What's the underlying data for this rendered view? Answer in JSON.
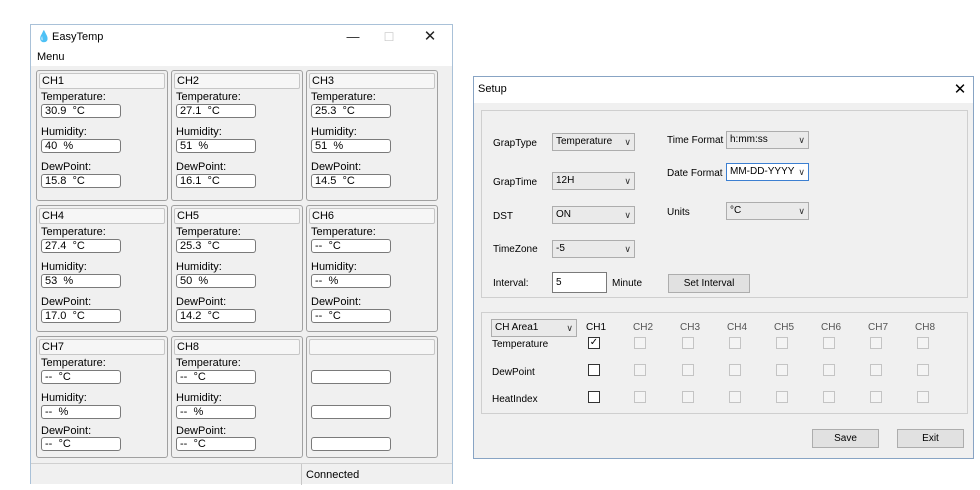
{
  "easytemp": {
    "title": "EasyTemp",
    "menu": "Menu",
    "status": "Connected",
    "labels": {
      "temperature": "Temperature:",
      "humidity": "Humidity:",
      "dewpoint": "DewPoint:"
    },
    "channels": [
      {
        "name": "CH1",
        "temperature": "30.9  °C",
        "humidity": "40  %",
        "dewpoint": "15.8  °C"
      },
      {
        "name": "CH2",
        "temperature": "27.1  °C",
        "humidity": "51  %",
        "dewpoint": "16.1  °C"
      },
      {
        "name": "CH3",
        "temperature": "25.3  °C",
        "humidity": "51  %",
        "dewpoint": "14.5  °C"
      },
      {
        "name": "CH4",
        "temperature": "27.4  °C",
        "humidity": "53  %",
        "dewpoint": "17.0  °C"
      },
      {
        "name": "CH5",
        "temperature": "25.3  °C",
        "humidity": "50  %",
        "dewpoint": "14.2  °C"
      },
      {
        "name": "CH6",
        "temperature": "--  °C",
        "humidity": "--  %",
        "dewpoint": "--  °C"
      },
      {
        "name": "CH7",
        "temperature": "--  °C",
        "humidity": "--  %",
        "dewpoint": "--  °C"
      },
      {
        "name": "CH8",
        "temperature": "--  °C",
        "humidity": "--  %",
        "dewpoint": "--  °C"
      }
    ]
  },
  "setup": {
    "title": "Setup",
    "graptype": {
      "label": "GrapType",
      "value": "Temperature"
    },
    "graptime": {
      "label": "GrapTime",
      "value": "12H"
    },
    "dst": {
      "label": "DST",
      "value": "ON"
    },
    "timezone": {
      "label": "TimeZone",
      "value": "-5"
    },
    "interval": {
      "label": "Interval:",
      "value": "5",
      "unit": "Minute"
    },
    "set_interval": "Set Interval",
    "time_format": {
      "label": "Time Format",
      "value": "h:mm:ss"
    },
    "date_format": {
      "label": "Date Format",
      "value": "MM-DD-YYYY"
    },
    "units": {
      "label": "Units",
      "value": "°C"
    },
    "area": "CH Area1",
    "columns": [
      "CH1",
      "CH2",
      "CH3",
      "CH4",
      "CH5",
      "CH6",
      "CH7",
      "CH8"
    ],
    "rows": [
      {
        "label": "Temperature",
        "checks": [
          true,
          false,
          false,
          false,
          false,
          false,
          false,
          false
        ]
      },
      {
        "label": "DewPoint",
        "checks": [
          false,
          false,
          false,
          false,
          false,
          false,
          false,
          false
        ]
      },
      {
        "label": "HeatIndex",
        "checks": [
          false,
          false,
          false,
          false,
          false,
          false,
          false,
          false
        ]
      }
    ],
    "save": "Save",
    "exit": "Exit",
    "colors": {
      "focus_border": "#3c7fd1",
      "window_border": "#88a4c4"
    }
  }
}
